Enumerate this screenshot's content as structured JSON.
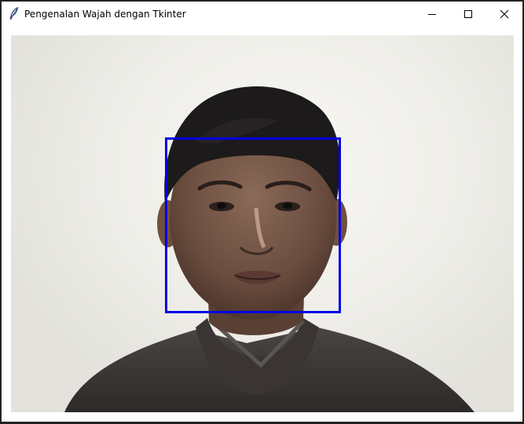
{
  "window": {
    "title": "Pengenalan Wajah dengan Tkinter",
    "app_icon": "tk-feather-icon",
    "controls": [
      "minimize-icon",
      "maximize-icon",
      "close-icon"
    ]
  },
  "camera": {
    "subject": "webcam frame of a person",
    "detection_color": "#0000e6"
  }
}
